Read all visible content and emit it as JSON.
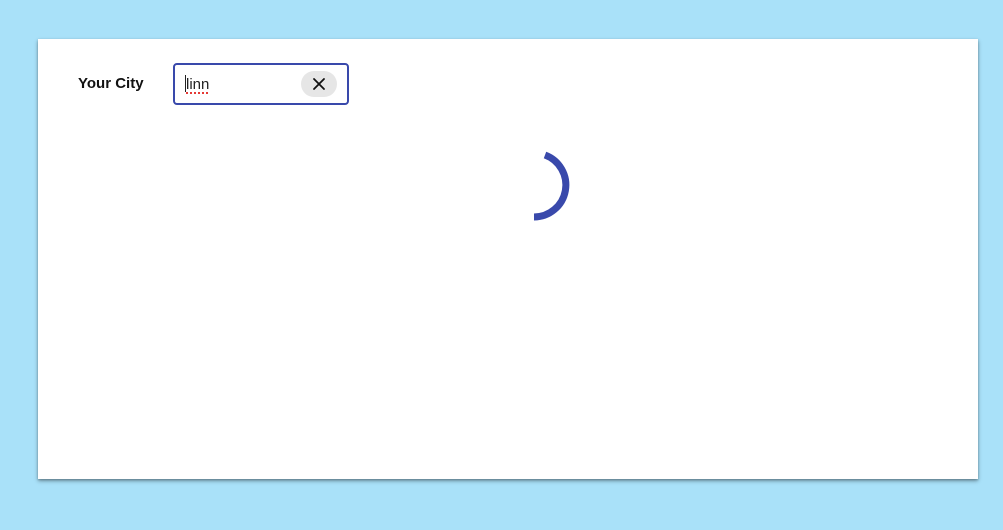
{
  "form": {
    "city_label": "Your City",
    "city_value": "linn",
    "clear_icon": "close-icon"
  },
  "loader": {
    "icon": "spinner-icon",
    "color": "#3949ab"
  },
  "colors": {
    "background": "#a9e1f9",
    "card": "#ffffff",
    "accent": "#3949ab"
  }
}
